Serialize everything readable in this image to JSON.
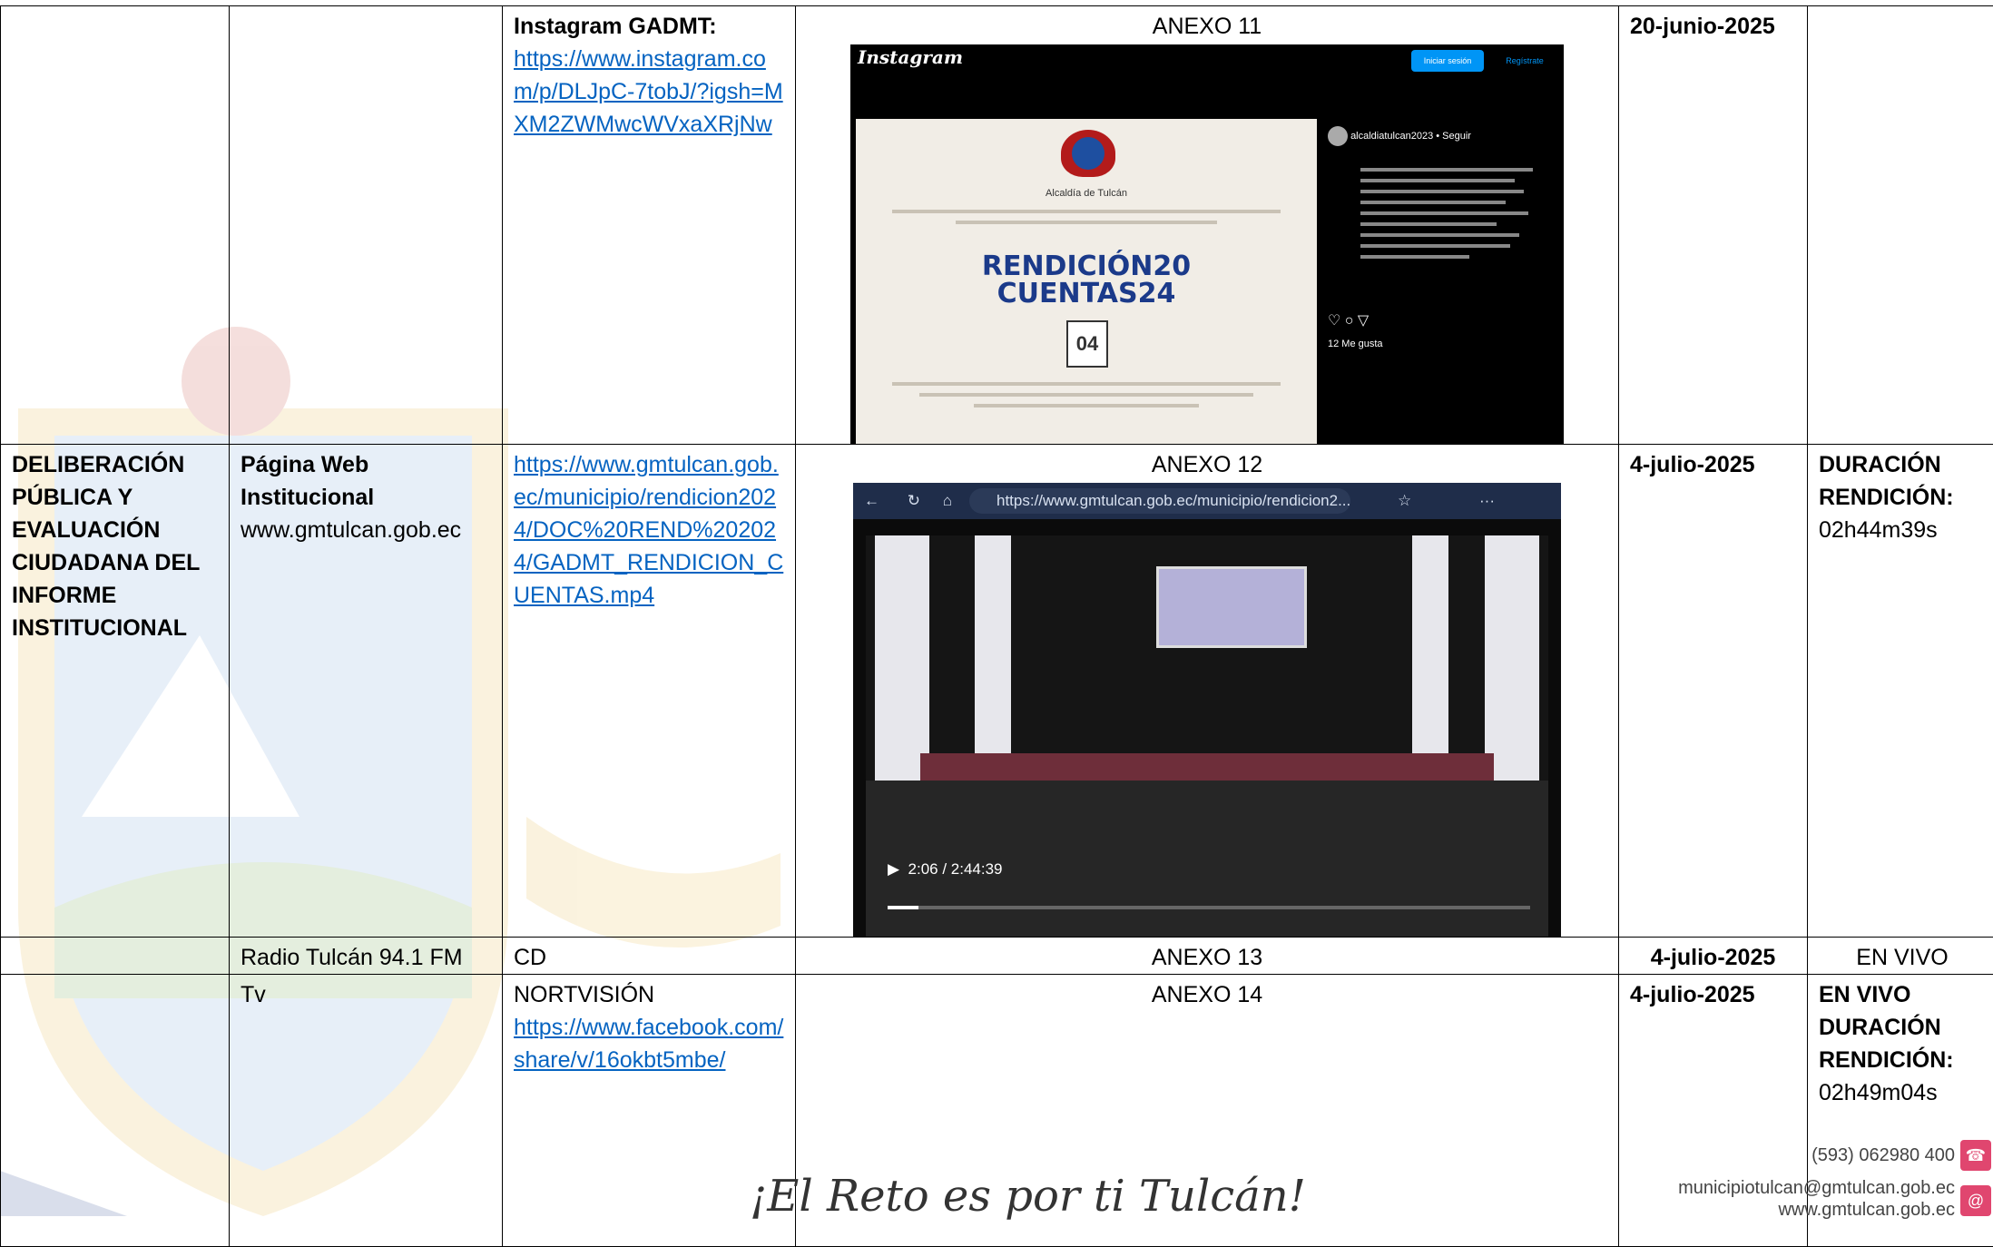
{
  "rows": [
    {
      "c1": "",
      "c2": {
        "bold": "",
        "text": ""
      },
      "c3": {
        "bold": "Instagram GADMT:",
        "link": "https://www.instagram.com/p/DLJpC-7tobJ/?igsh=MXM2ZWMwcWVxaXRjNw",
        "text": ""
      },
      "c4": {
        "annex": "ANEXO 11"
      },
      "c5": "20-junio-2025",
      "c6": {
        "bold": "",
        "text": ""
      }
    },
    {
      "c1": "DELIBERACIÓN PÚBLICA Y EVALUACIÓN CIUDADANA DEL INFORME INSTITUCIONAL",
      "c2": {
        "bold": "Página Web Institucional",
        "text": "www.gmtulcan.gob.ec"
      },
      "c3": {
        "bold": "",
        "link": "https://www.gmtulcan.gob.ec/municipio/rendicion2024/DOC%20REND%202024/GADMT_RENDICION_CUENTAS.mp4",
        "text": ""
      },
      "c4": {
        "annex": "ANEXO 12"
      },
      "c5": "4-julio-2025",
      "c6": {
        "bold": "DURACIÓN RENDICIÓN:",
        "text": "02h44m39s"
      }
    },
    {
      "c1": "",
      "c2": {
        "bold": "",
        "text": "Radio Tulcán 94.1 FM"
      },
      "c3": {
        "bold": "",
        "link": "",
        "text": "CD"
      },
      "c4": {
        "annex": "ANEXO 13"
      },
      "c5": "4-julio-2025",
      "c6": {
        "bold": "",
        "text": "EN VIVO"
      }
    },
    {
      "c1": "",
      "c2": {
        "bold": "",
        "text": "Tv"
      },
      "c3": {
        "bold": "",
        "text": "NORTVISIÓN",
        "link": "https://www.facebook.com/share/v/16okbt5mbe/"
      },
      "c4": {
        "annex": "ANEXO 14"
      },
      "c5": "4-julio-2025",
      "c6": {
        "bold": "EN VIVO DURACIÓN RENDICIÓN:",
        "text": "02h49m04s"
      }
    }
  ],
  "instagram_shot": {
    "logo": "Instagram",
    "login": "Iniciar sesión",
    "register": "Regístrate",
    "account": "alcaldiatulcan2023 • Seguir",
    "poster_org": "Alcaldía de Tulcán",
    "poster_line1": "RENDICIÓN20",
    "poster_line2": "CUENTAS24",
    "poster_day": "04",
    "likes": "12 Me gusta"
  },
  "video_shot": {
    "url": "https://www.gmtulcan.gob.ec/municipio/rendicion2...",
    "time": "2:06 / 2:44:39",
    "progress": 0.048
  },
  "footer": {
    "slogan": "¡El Reto es por ti Tulcán!",
    "phone": "(593) 062980 400",
    "email": "municipiotulcan@gmtulcan.gob.ec",
    "web": "www.gmtulcan.gob.ec"
  },
  "colors": {
    "link": "#0563c1",
    "accent": "#e0466f"
  }
}
